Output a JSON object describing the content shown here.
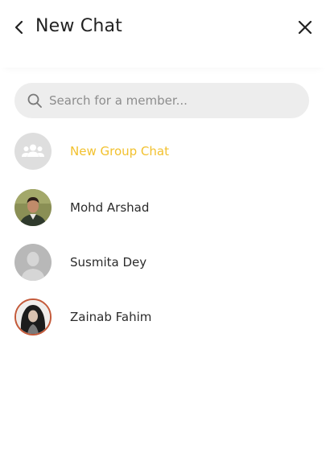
{
  "header": {
    "title": "New Chat",
    "back_icon": "chevron-left-icon",
    "close_icon": "close-icon"
  },
  "search": {
    "placeholder": "Search for a member...",
    "value": "",
    "icon": "search-icon"
  },
  "group_chat": {
    "label": "New Group Chat",
    "icon": "group-icon",
    "accent_color": "#f2c12e"
  },
  "members": [
    {
      "name": "Mohd Arshad",
      "avatar": "photo"
    },
    {
      "name": "Susmita Dey",
      "avatar": "default-user"
    },
    {
      "name": "Zainab Fahim",
      "avatar": "photo"
    }
  ],
  "colors": {
    "search_bg": "#ededed",
    "avatar_placeholder": "#b8b8b8",
    "text": "#2b2b2b"
  }
}
